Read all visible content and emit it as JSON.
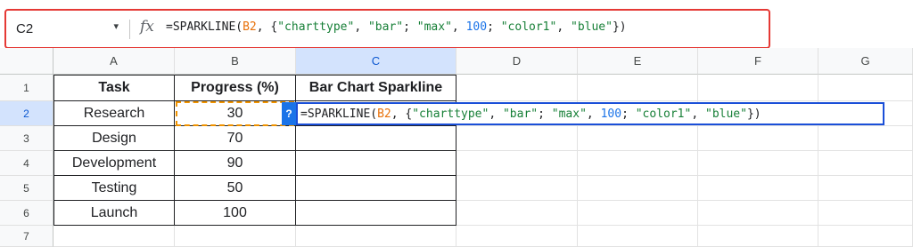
{
  "formula_bar": {
    "name_box": "C2",
    "name_box_dropdown_icon": "dropdown-arrow",
    "fx_label": "fx",
    "formula_tokens": [
      {
        "text": "=SPARKLINE(",
        "kind": "plain"
      },
      {
        "text": "B2",
        "kind": "ref"
      },
      {
        "text": ", {",
        "kind": "plain"
      },
      {
        "text": "\"charttype\"",
        "kind": "str"
      },
      {
        "text": ", ",
        "kind": "plain"
      },
      {
        "text": "\"bar\"",
        "kind": "str"
      },
      {
        "text": "; ",
        "kind": "plain"
      },
      {
        "text": "\"max\"",
        "kind": "str"
      },
      {
        "text": ", ",
        "kind": "plain"
      },
      {
        "text": "100",
        "kind": "num"
      },
      {
        "text": "; ",
        "kind": "plain"
      },
      {
        "text": "\"color1\"",
        "kind": "str"
      },
      {
        "text": ", ",
        "kind": "plain"
      },
      {
        "text": "\"blue\"",
        "kind": "str"
      },
      {
        "text": "})",
        "kind": "plain"
      }
    ]
  },
  "columns": [
    "A",
    "B",
    "C",
    "D",
    "E",
    "F",
    "G"
  ],
  "rows": [
    "1",
    "2",
    "3",
    "4",
    "5",
    "6",
    "7"
  ],
  "selected_column": "C",
  "selected_row": "2",
  "table": {
    "headers": [
      "Task",
      "Progress (%)",
      "Bar Chart Sparkline"
    ],
    "data": [
      [
        "Research",
        "30"
      ],
      [
        "Design",
        "70"
      ],
      [
        "Development",
        "90"
      ],
      [
        "Testing",
        "50"
      ],
      [
        "Launch",
        "100"
      ]
    ]
  },
  "cell_editor": {
    "help_badge": "?",
    "formula_tokens": [
      {
        "text": "=SPARKLINE(",
        "kind": "plain"
      },
      {
        "text": "B2",
        "kind": "ref"
      },
      {
        "text": ", {",
        "kind": "plain"
      },
      {
        "text": "\"charttype\"",
        "kind": "str"
      },
      {
        "text": ", ",
        "kind": "plain"
      },
      {
        "text": "\"bar\"",
        "kind": "str"
      },
      {
        "text": "; ",
        "kind": "plain"
      },
      {
        "text": "\"max\"",
        "kind": "str"
      },
      {
        "text": ", ",
        "kind": "plain"
      },
      {
        "text": "100",
        "kind": "num"
      },
      {
        "text": "; ",
        "kind": "plain"
      },
      {
        "text": "\"color1\"",
        "kind": "str"
      },
      {
        "text": ", ",
        "kind": "plain"
      },
      {
        "text": "\"blue\"",
        "kind": "str"
      },
      {
        "text": "})",
        "kind": "plain"
      }
    ]
  },
  "colors": {
    "highlight_border": "#e53935",
    "selection_blue": "#1a4fd8",
    "ref_orange": "#e8710a",
    "string_green": "#188038",
    "number_blue": "#1a73e8"
  }
}
